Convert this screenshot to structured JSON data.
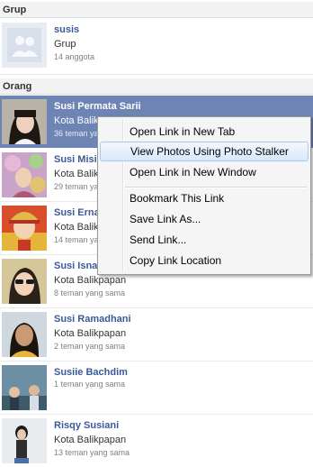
{
  "groups": {
    "header": "Grup",
    "items": [
      {
        "name": "susis",
        "sub": "Grup",
        "meta": "14 anggota"
      }
    ]
  },
  "people": {
    "header": "Orang",
    "items": [
      {
        "name": "Susi Permata Sarii",
        "sub": "Kota Balikpapan",
        "meta": "36 teman yang sama"
      },
      {
        "name": "Susi Misi",
        "sub": "Kota Balikpapan",
        "meta": "29 teman yang sama"
      },
      {
        "name": "Susi Erna",
        "sub": "Kota Balikpapan",
        "meta": "14 teman yang sama"
      },
      {
        "name": "Susi Isna",
        "sub": "Kota Balikpapan",
        "meta": "8 teman yang sama"
      },
      {
        "name": "Susi Ramadhani",
        "sub": "Kota Balikpapan",
        "meta": "2 teman yang sama"
      },
      {
        "name": "Susiie Bachdim",
        "sub": "",
        "meta": "1 teman yang sama"
      },
      {
        "name": "Risqy Susiani",
        "sub": "Kota Balikpapan",
        "meta": "13 teman yang sama"
      }
    ]
  },
  "context_menu": {
    "items": [
      "Open Link in New Tab",
      "View Photos Using Photo Stalker",
      "Open Link in New Window",
      "Bookmark This Link",
      "Save Link As...",
      "Send Link...",
      "Copy Link Location"
    ],
    "hovered": "View Photos Using Photo Stalker"
  },
  "colors": {
    "highlight": "#6d84b4",
    "link": "#3b5998",
    "section_bg": "#f2f2f2"
  }
}
